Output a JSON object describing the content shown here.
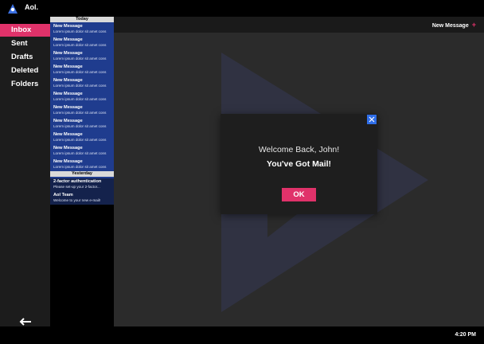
{
  "app": {
    "name": "Aol."
  },
  "sidebar": {
    "items": [
      {
        "label": "Inbox"
      },
      {
        "label": "Sent"
      },
      {
        "label": "Drafts"
      },
      {
        "label": "Deleted"
      },
      {
        "label": "Folders"
      }
    ],
    "back_icon": "arrow-left-icon"
  },
  "messages": {
    "today_header": "Today",
    "today": [
      {
        "subject": "New Message",
        "preview": "Lorem ipsum dolor sit amet cons"
      },
      {
        "subject": "New Message",
        "preview": "Lorem ipsum dolor sit amet cons"
      },
      {
        "subject": "New Message",
        "preview": "Lorem ipsum dolor sit amet cons"
      },
      {
        "subject": "New Message",
        "preview": "Lorem ipsum dolor sit amet cons"
      },
      {
        "subject": "New Message",
        "preview": "Lorem ipsum dolor sit amet cons"
      },
      {
        "subject": "New Message",
        "preview": "Lorem ipsum dolor sit amet cons"
      },
      {
        "subject": "New Message",
        "preview": "Lorem ipsum dolor sit amet cons"
      },
      {
        "subject": "New Message",
        "preview": "Lorem ipsum dolor sit amet cons"
      },
      {
        "subject": "New Message",
        "preview": "Lorem ipsum dolor sit amet cons"
      },
      {
        "subject": "New Message",
        "preview": "Lorem ipsum dolor sit amet cons"
      },
      {
        "subject": "New Message",
        "preview": "Lorem ipsum dolor sit amet cons"
      }
    ],
    "yesterday_header": "Yesterday",
    "yesterday": [
      {
        "subject": "2-factor authentication",
        "preview": "Please set-up your 2-factor..."
      },
      {
        "subject": "Aol Team",
        "preview": "Welcome to your new e-mail!"
      }
    ]
  },
  "main": {
    "new_message_label": "New Message",
    "new_message_icon": "plus-icon"
  },
  "modal": {
    "welcome": "Welcome Back, John!",
    "headline": "You've Got Mail!",
    "ok_label": "OK",
    "close_icon": "close-icon"
  },
  "status": {
    "time": "4:20 PM"
  },
  "colors": {
    "accent": "#e0326a",
    "list_blue": "#1f3c8e",
    "close_blue": "#2f6ee8",
    "logo_blue": "#3b6fe0"
  }
}
